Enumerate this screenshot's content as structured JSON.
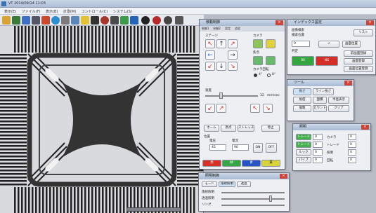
{
  "titlebar": {
    "title": "VT 2014/09/14 11:03"
  },
  "menu": [
    "表示(E)",
    "ファイル(F)",
    "表示(B)",
    "計測(M)",
    "コントロール(C)",
    "システム(S)"
  ],
  "motion_panel": {
    "title": "移動制御",
    "tabs": [
      "制御1",
      "制御2",
      "設定",
      "追従",
      "位置",
      "登録"
    ],
    "stage_label": "ステージ",
    "camera_label": "カメラ",
    "focus_label": "焦点",
    "camera_rotate_label": "カメラ回転",
    "rotate_options": [
      "4°",
      "8°"
    ],
    "speed_label": "速度",
    "speed_unit": "mm/sec",
    "speed_value": "32",
    "home_button": "ホーム",
    "center_button": "原点",
    "stretch_button": "ストレッチ",
    "stop_button": "停止",
    "pos_label": "位置",
    "voltage_label": "電圧",
    "current_label": "電流",
    "voltage_value": "45",
    "current_value": "90",
    "on_button": "ON",
    "off_button": "OFF",
    "color_buttons": [
      "赤",
      "緑",
      "青",
      "黄"
    ],
    "colors": {
      "red": "#d73028",
      "green": "#35a545",
      "blue": "#2753c7",
      "yellow": "#d8d33a"
    }
  },
  "index_panel": {
    "title": "インデックス設定",
    "field1_label": "画像検索",
    "field2_label": "検索位置",
    "list_label": "リスト",
    "index_value": "0",
    "btn_a": "<",
    "btn_b": "画面位置",
    "judge_label": "判定",
    "ok_label": "OK",
    "ng_label": "NG",
    "side_buttons": [
      "前画面登録",
      "画面登録",
      "画面位置登録"
    ]
  },
  "tool_panel": {
    "title": "ツール",
    "buttons": [
      "長さ",
      "ライン長さ",
      "角度",
      "面積",
      "半径表示",
      "個数",
      "カウント",
      "クリア"
    ]
  },
  "light_panel": {
    "title": "照明",
    "rows": [
      {
        "label": "トレード",
        "value": "0",
        "extra": "カメラ",
        "v2": "0"
      },
      {
        "label": "トレード",
        "value": "0",
        "extra": "トレード",
        "v2": "0"
      },
      {
        "label": "ルック",
        "value": "0",
        "extra": "照明",
        "v2": "0"
      },
      {
        "label": "パイプ",
        "value": "0",
        "extra": "回転",
        "v2": "0"
      }
    ]
  },
  "bottom_panel": {
    "title": "照明制御",
    "tabs": [
      "モード",
      "落射照明",
      "透過"
    ],
    "rows": [
      "落射照明",
      "透過照明",
      "リング"
    ]
  }
}
